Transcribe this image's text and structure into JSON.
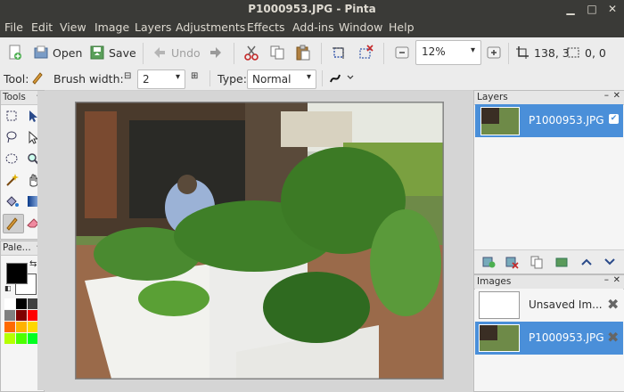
{
  "window": {
    "title": "P1000953.JPG - Pinta"
  },
  "menu": [
    "File",
    "Edit",
    "View",
    "Image",
    "Layers",
    "Adjustments",
    "Effects",
    "Add-ins",
    "Window",
    "Help"
  ],
  "toolbar": {
    "open_label": "Open",
    "save_label": "Save",
    "undo_label": "Undo",
    "zoom_value": "12%",
    "cursor_pos": "138, 3",
    "selection_size": "0, 0"
  },
  "options": {
    "tool_label": "Tool:",
    "brush_width_label": "Brush width:",
    "brush_width_value": "2",
    "type_label": "Type:",
    "type_value": "Normal"
  },
  "panels": {
    "tools_title": "Tools",
    "palette_title": "Pale...",
    "layers_title": "Layers",
    "images_title": "Images"
  },
  "layers": [
    {
      "name": "P1000953.JPG",
      "visible": true,
      "selected": true
    }
  ],
  "images": [
    {
      "name": "Unsaved Im...",
      "selected": false
    },
    {
      "name": "P1000953.JPG",
      "selected": true
    }
  ],
  "colors": {
    "primary": "#000000",
    "secondary": "#ffffff",
    "accent": "#4a8fd9",
    "palette": [
      "#ffffff",
      "#000000",
      "#404040",
      "#808080",
      "#7f0000",
      "#ff0000",
      "#ff6a00",
      "#ffb200",
      "#ffd800",
      "#b6ff00",
      "#4cff00",
      "#00ff21"
    ]
  }
}
